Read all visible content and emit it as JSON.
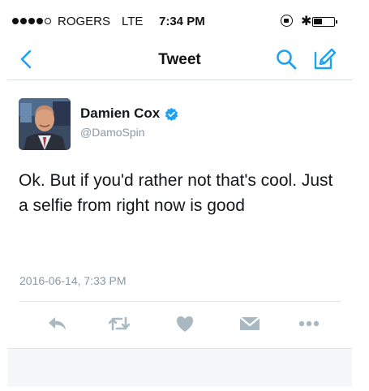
{
  "status_bar": {
    "carrier": "ROGERS",
    "network": "LTE",
    "time": "7:34 PM"
  },
  "nav": {
    "title": "Tweet"
  },
  "tweet": {
    "display_name": "Damien Cox",
    "handle": "@DamoSpin",
    "verified": true,
    "text": "Ok. But if you'd rather not that's cool. Just a selfie from right now is good",
    "timestamp": "2016-06-14, 7:33 PM"
  },
  "actions": [
    "reply-icon",
    "retweet-icon",
    "like-icon",
    "direct-message-icon",
    "more-icon"
  ],
  "colors": {
    "accent": "#1da1f2",
    "muted": "#8899a6",
    "action_icon": "#aab8c2",
    "text": "#14171a"
  }
}
